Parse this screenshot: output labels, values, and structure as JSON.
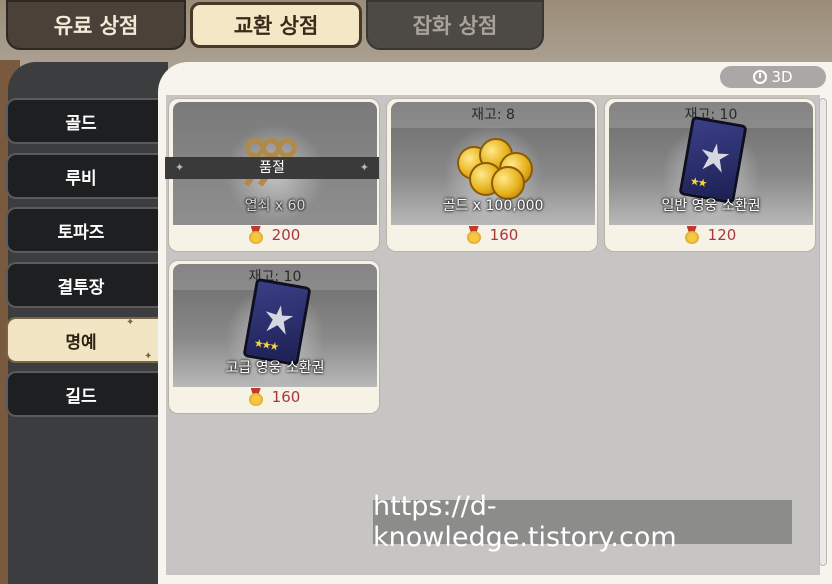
{
  "top_tabs": [
    {
      "label": "유료 상점",
      "active": false
    },
    {
      "label": "교환 상점",
      "active": true
    },
    {
      "label": "잡화 상점",
      "active": false
    }
  ],
  "sidebar": {
    "items": [
      {
        "label": "골드",
        "active": false
      },
      {
        "label": "루비",
        "active": false
      },
      {
        "label": "토파즈",
        "active": false
      },
      {
        "label": "결투장",
        "active": false
      },
      {
        "label": "명예",
        "active": true
      },
      {
        "label": "길드",
        "active": false
      }
    ]
  },
  "refresh_badge": {
    "label": "3D",
    "icon": "timer-icon"
  },
  "items": [
    {
      "stock": "",
      "sold_out_label": "품절",
      "name": "열쇠 x 60",
      "price": "200",
      "icon": "key-icon",
      "sold_out": true
    },
    {
      "stock": "재고: 8",
      "name": "골드 x 100,000",
      "price": "160",
      "icon": "gold-coins-icon",
      "sold_out": false
    },
    {
      "stock": "재고: 10",
      "name": "일반 영웅 소환권",
      "price": "120",
      "icon": "hero-ticket-icon",
      "sold_out": false
    },
    {
      "stock": "재고: 10",
      "name": "고급 영웅 소환권",
      "price": "160",
      "icon": "hero-ticket-icon",
      "sold_out": false
    }
  ],
  "currency_icon": "honor-medal-icon",
  "colors": {
    "price": "#a9363d",
    "active_tab": "#f3e7c6"
  },
  "watermark": "https://d-knowledge.tistory.com"
}
